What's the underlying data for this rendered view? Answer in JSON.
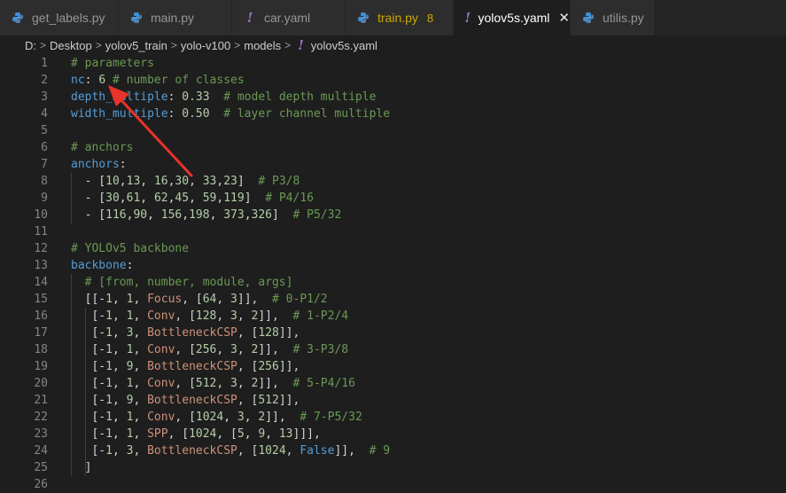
{
  "tabs": [
    {
      "label": "get_labels.py",
      "icon": "python-icon",
      "kind": "py",
      "active": false,
      "badge": ""
    },
    {
      "label": "main.py",
      "icon": "python-icon",
      "kind": "py",
      "active": false,
      "badge": ""
    },
    {
      "label": "car.yaml",
      "icon": "yaml-icon",
      "kind": "yaml",
      "active": false,
      "badge": ""
    },
    {
      "label": "train.py",
      "icon": "python-icon",
      "kind": "py",
      "active": false,
      "badge": "8"
    },
    {
      "label": "yolov5s.yaml",
      "icon": "yaml-icon",
      "kind": "yaml",
      "active": true,
      "badge": ""
    },
    {
      "label": "utilis.py",
      "icon": "python-icon",
      "kind": "py",
      "active": false,
      "badge": ""
    }
  ],
  "breadcrumb": [
    "D:",
    "Desktop",
    "yolov5_train",
    "yolo-v100",
    "models",
    "yolov5s.yaml"
  ],
  "colors": {
    "accent": "#007acc",
    "arrow": "#e8332a",
    "modified": "#cca700"
  },
  "code_lines": [
    {
      "n": "1",
      "tokens": [
        [
          "c-com",
          "# parameters"
        ]
      ]
    },
    {
      "n": "2",
      "tokens": [
        [
          "c-key",
          "nc"
        ],
        [
          "c-plain",
          ": "
        ],
        [
          "c-num",
          "6"
        ],
        [
          "c-plain",
          " "
        ],
        [
          "c-com",
          "# number of classes"
        ]
      ]
    },
    {
      "n": "3",
      "tokens": [
        [
          "c-key",
          "depth_multiple"
        ],
        [
          "c-plain",
          ": "
        ],
        [
          "c-num",
          "0.33"
        ],
        [
          "c-plain",
          "  "
        ],
        [
          "c-com",
          "# model depth multiple"
        ]
      ]
    },
    {
      "n": "4",
      "tokens": [
        [
          "c-key",
          "width_multiple"
        ],
        [
          "c-plain",
          ": "
        ],
        [
          "c-num",
          "0.50"
        ],
        [
          "c-plain",
          "  "
        ],
        [
          "c-com",
          "# layer channel multiple"
        ]
      ]
    },
    {
      "n": "5",
      "tokens": []
    },
    {
      "n": "6",
      "tokens": [
        [
          "c-com",
          "# anchors"
        ]
      ]
    },
    {
      "n": "7",
      "tokens": [
        [
          "c-key",
          "anchors"
        ],
        [
          "c-plain",
          ":"
        ]
      ]
    },
    {
      "n": "8",
      "tokens": [
        [
          "c-plain",
          "  - ["
        ],
        [
          "c-num",
          "10"
        ],
        [
          "c-plain",
          ","
        ],
        [
          "c-num",
          "13"
        ],
        [
          "c-plain",
          ", "
        ],
        [
          "c-num",
          "16"
        ],
        [
          "c-plain",
          ","
        ],
        [
          "c-num",
          "30"
        ],
        [
          "c-plain",
          ", "
        ],
        [
          "c-num",
          "33"
        ],
        [
          "c-plain",
          ","
        ],
        [
          "c-num",
          "23"
        ],
        [
          "c-plain",
          "]  "
        ],
        [
          "c-com",
          "# P3/8"
        ]
      ]
    },
    {
      "n": "9",
      "tokens": [
        [
          "c-plain",
          "  - ["
        ],
        [
          "c-num",
          "30"
        ],
        [
          "c-plain",
          ","
        ],
        [
          "c-num",
          "61"
        ],
        [
          "c-plain",
          ", "
        ],
        [
          "c-num",
          "62"
        ],
        [
          "c-plain",
          ","
        ],
        [
          "c-num",
          "45"
        ],
        [
          "c-plain",
          ", "
        ],
        [
          "c-num",
          "59"
        ],
        [
          "c-plain",
          ","
        ],
        [
          "c-num",
          "119"
        ],
        [
          "c-plain",
          "]  "
        ],
        [
          "c-com",
          "# P4/16"
        ]
      ]
    },
    {
      "n": "10",
      "tokens": [
        [
          "c-plain",
          "  - ["
        ],
        [
          "c-num",
          "116"
        ],
        [
          "c-plain",
          ","
        ],
        [
          "c-num",
          "90"
        ],
        [
          "c-plain",
          ", "
        ],
        [
          "c-num",
          "156"
        ],
        [
          "c-plain",
          ","
        ],
        [
          "c-num",
          "198"
        ],
        [
          "c-plain",
          ", "
        ],
        [
          "c-num",
          "373"
        ],
        [
          "c-plain",
          ","
        ],
        [
          "c-num",
          "326"
        ],
        [
          "c-plain",
          "]  "
        ],
        [
          "c-com",
          "# P5/32"
        ]
      ]
    },
    {
      "n": "11",
      "tokens": []
    },
    {
      "n": "12",
      "tokens": [
        [
          "c-com",
          "# YOLOv5 backbone"
        ]
      ]
    },
    {
      "n": "13",
      "tokens": [
        [
          "c-key",
          "backbone"
        ],
        [
          "c-plain",
          ":"
        ]
      ]
    },
    {
      "n": "14",
      "tokens": [
        [
          "c-plain",
          "  "
        ],
        [
          "c-com",
          "# [from, number, module, args]"
        ]
      ]
    },
    {
      "n": "15",
      "tokens": [
        [
          "c-plain",
          "  [[-"
        ],
        [
          "c-num",
          "1"
        ],
        [
          "c-plain",
          ", "
        ],
        [
          "c-num",
          "1"
        ],
        [
          "c-plain",
          ", "
        ],
        [
          "c-cls",
          "Focus"
        ],
        [
          "c-plain",
          ", ["
        ],
        [
          "c-num",
          "64"
        ],
        [
          "c-plain",
          ", "
        ],
        [
          "c-num",
          "3"
        ],
        [
          "c-plain",
          "]],  "
        ],
        [
          "c-com",
          "# 0-P1/2"
        ]
      ]
    },
    {
      "n": "16",
      "tokens": [
        [
          "c-plain",
          "   [-"
        ],
        [
          "c-num",
          "1"
        ],
        [
          "c-plain",
          ", "
        ],
        [
          "c-num",
          "1"
        ],
        [
          "c-plain",
          ", "
        ],
        [
          "c-cls",
          "Conv"
        ],
        [
          "c-plain",
          ", ["
        ],
        [
          "c-num",
          "128"
        ],
        [
          "c-plain",
          ", "
        ],
        [
          "c-num",
          "3"
        ],
        [
          "c-plain",
          ", "
        ],
        [
          "c-num",
          "2"
        ],
        [
          "c-plain",
          "]],  "
        ],
        [
          "c-com",
          "# 1-P2/4"
        ]
      ]
    },
    {
      "n": "17",
      "tokens": [
        [
          "c-plain",
          "   [-"
        ],
        [
          "c-num",
          "1"
        ],
        [
          "c-plain",
          ", "
        ],
        [
          "c-num",
          "3"
        ],
        [
          "c-plain",
          ", "
        ],
        [
          "c-cls",
          "BottleneckCSP"
        ],
        [
          "c-plain",
          ", ["
        ],
        [
          "c-num",
          "128"
        ],
        [
          "c-plain",
          "]],"
        ]
      ]
    },
    {
      "n": "18",
      "tokens": [
        [
          "c-plain",
          "   [-"
        ],
        [
          "c-num",
          "1"
        ],
        [
          "c-plain",
          ", "
        ],
        [
          "c-num",
          "1"
        ],
        [
          "c-plain",
          ", "
        ],
        [
          "c-cls",
          "Conv"
        ],
        [
          "c-plain",
          ", ["
        ],
        [
          "c-num",
          "256"
        ],
        [
          "c-plain",
          ", "
        ],
        [
          "c-num",
          "3"
        ],
        [
          "c-plain",
          ", "
        ],
        [
          "c-num",
          "2"
        ],
        [
          "c-plain",
          "]],  "
        ],
        [
          "c-com",
          "# 3-P3/8"
        ]
      ]
    },
    {
      "n": "19",
      "tokens": [
        [
          "c-plain",
          "   [-"
        ],
        [
          "c-num",
          "1"
        ],
        [
          "c-plain",
          ", "
        ],
        [
          "c-num",
          "9"
        ],
        [
          "c-plain",
          ", "
        ],
        [
          "c-cls",
          "BottleneckCSP"
        ],
        [
          "c-plain",
          ", ["
        ],
        [
          "c-num",
          "256"
        ],
        [
          "c-plain",
          "]],"
        ]
      ]
    },
    {
      "n": "20",
      "tokens": [
        [
          "c-plain",
          "   [-"
        ],
        [
          "c-num",
          "1"
        ],
        [
          "c-plain",
          ", "
        ],
        [
          "c-num",
          "1"
        ],
        [
          "c-plain",
          ", "
        ],
        [
          "c-cls",
          "Conv"
        ],
        [
          "c-plain",
          ", ["
        ],
        [
          "c-num",
          "512"
        ],
        [
          "c-plain",
          ", "
        ],
        [
          "c-num",
          "3"
        ],
        [
          "c-plain",
          ", "
        ],
        [
          "c-num",
          "2"
        ],
        [
          "c-plain",
          "]],  "
        ],
        [
          "c-com",
          "# 5-P4/16"
        ]
      ]
    },
    {
      "n": "21",
      "tokens": [
        [
          "c-plain",
          "   [-"
        ],
        [
          "c-num",
          "1"
        ],
        [
          "c-plain",
          ", "
        ],
        [
          "c-num",
          "9"
        ],
        [
          "c-plain",
          ", "
        ],
        [
          "c-cls",
          "BottleneckCSP"
        ],
        [
          "c-plain",
          ", ["
        ],
        [
          "c-num",
          "512"
        ],
        [
          "c-plain",
          "]],"
        ]
      ]
    },
    {
      "n": "22",
      "tokens": [
        [
          "c-plain",
          "   [-"
        ],
        [
          "c-num",
          "1"
        ],
        [
          "c-plain",
          ", "
        ],
        [
          "c-num",
          "1"
        ],
        [
          "c-plain",
          ", "
        ],
        [
          "c-cls",
          "Conv"
        ],
        [
          "c-plain",
          ", ["
        ],
        [
          "c-num",
          "1024"
        ],
        [
          "c-plain",
          ", "
        ],
        [
          "c-num",
          "3"
        ],
        [
          "c-plain",
          ", "
        ],
        [
          "c-num",
          "2"
        ],
        [
          "c-plain",
          "]],  "
        ],
        [
          "c-com",
          "# 7-P5/32"
        ]
      ]
    },
    {
      "n": "23",
      "tokens": [
        [
          "c-plain",
          "   [-"
        ],
        [
          "c-num",
          "1"
        ],
        [
          "c-plain",
          ", "
        ],
        [
          "c-num",
          "1"
        ],
        [
          "c-plain",
          ", "
        ],
        [
          "c-cls",
          "SPP"
        ],
        [
          "c-plain",
          ", ["
        ],
        [
          "c-num",
          "1024"
        ],
        [
          "c-plain",
          ", ["
        ],
        [
          "c-num",
          "5"
        ],
        [
          "c-plain",
          ", "
        ],
        [
          "c-num",
          "9"
        ],
        [
          "c-plain",
          ", "
        ],
        [
          "c-num",
          "13"
        ],
        [
          "c-plain",
          "]]],"
        ]
      ]
    },
    {
      "n": "24",
      "tokens": [
        [
          "c-plain",
          "   [-"
        ],
        [
          "c-num",
          "1"
        ],
        [
          "c-plain",
          ", "
        ],
        [
          "c-num",
          "3"
        ],
        [
          "c-plain",
          ", "
        ],
        [
          "c-cls",
          "BottleneckCSP"
        ],
        [
          "c-plain",
          ", ["
        ],
        [
          "c-num",
          "1024"
        ],
        [
          "c-plain",
          ", "
        ],
        [
          "c-kw",
          "False"
        ],
        [
          "c-plain",
          "]],  "
        ],
        [
          "c-com",
          "# 9"
        ]
      ]
    },
    {
      "n": "25",
      "tokens": [
        [
          "c-plain",
          "  ]"
        ]
      ]
    },
    {
      "n": "26",
      "tokens": []
    }
  ]
}
